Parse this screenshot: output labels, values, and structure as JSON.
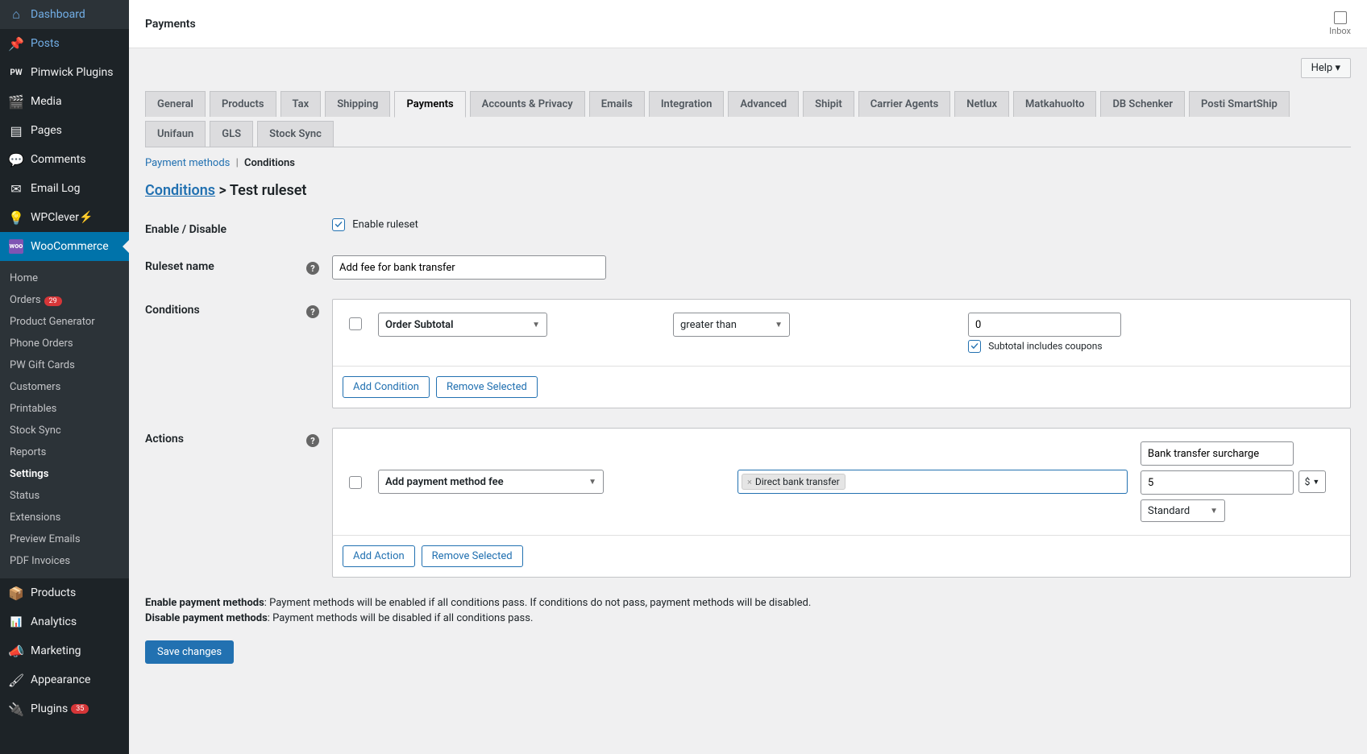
{
  "topbar": {
    "title": "Payments",
    "inbox": "Inbox",
    "help": "Help"
  },
  "sidebar": {
    "items": [
      {
        "icon": "dashboard",
        "label": "Dashboard"
      },
      {
        "icon": "pin",
        "label": "Posts",
        "class": "posts"
      },
      {
        "icon": "pw",
        "label": "Pimwick Plugins"
      },
      {
        "icon": "media",
        "label": "Media"
      },
      {
        "icon": "pages",
        "label": "Pages"
      },
      {
        "icon": "comments",
        "label": "Comments"
      },
      {
        "icon": "email",
        "label": "Email Log"
      },
      {
        "icon": "wpclever",
        "label": "WPClever",
        "lightning": true
      },
      {
        "icon": "woo",
        "label": "WooCommerce",
        "active": true
      },
      {
        "icon": "products",
        "label": "Products"
      },
      {
        "icon": "analytics",
        "label": "Analytics"
      },
      {
        "icon": "marketing",
        "label": "Marketing"
      },
      {
        "icon": "appearance",
        "label": "Appearance"
      },
      {
        "icon": "plugins",
        "label": "Plugins",
        "badge": "35"
      }
    ],
    "submenu": [
      {
        "label": "Home"
      },
      {
        "label": "Orders",
        "badge": "29"
      },
      {
        "label": "Product Generator"
      },
      {
        "label": "Phone Orders"
      },
      {
        "label": "PW Gift Cards"
      },
      {
        "label": "Customers"
      },
      {
        "label": "Printables"
      },
      {
        "label": "Stock Sync"
      },
      {
        "label": "Reports"
      },
      {
        "label": "Settings",
        "current": true
      },
      {
        "label": "Status"
      },
      {
        "label": "Extensions"
      },
      {
        "label": "Preview Emails"
      },
      {
        "label": "PDF Invoices"
      }
    ]
  },
  "tabs": [
    "General",
    "Products",
    "Tax",
    "Shipping",
    "Payments",
    "Accounts & Privacy",
    "Emails",
    "Integration",
    "Advanced",
    "Shipit",
    "Carrier Agents",
    "Netlux",
    "Matkahuolto",
    "DB Schenker",
    "Posti SmartShip",
    "Unifaun",
    "GLS",
    "Stock Sync"
  ],
  "active_tab": "Payments",
  "breadcrumb": {
    "link": "Payment methods",
    "current": "Conditions"
  },
  "page_title": {
    "link": "Conditions",
    "sep": " > ",
    "name": "Test ruleset"
  },
  "form": {
    "enable_label": "Enable / Disable",
    "enable_check": "Enable ruleset",
    "name_label": "Ruleset name",
    "name_value": "Add fee for bank transfer",
    "conditions_label": "Conditions",
    "actions_label": "Actions"
  },
  "condition_row": {
    "field": "Order Subtotal",
    "operator": "greater than",
    "value": "0",
    "extra": "Subtotal includes coupons"
  },
  "action_row": {
    "field": "Add payment method fee",
    "tag": "Direct bank transfer",
    "name": "Bank transfer surcharge",
    "amount": "5",
    "currency": "$",
    "tax": "Standard"
  },
  "buttons": {
    "add_condition": "Add Condition",
    "remove_selected": "Remove Selected",
    "add_action": "Add Action",
    "save": "Save changes"
  },
  "desc": {
    "enable_b": "Enable payment methods",
    "enable_t": ": Payment methods will be enabled if all conditions pass. If conditions do not pass, payment methods will be disabled.",
    "disable_b": "Disable payment methods",
    "disable_t": ": Payment methods will be disabled if all conditions pass."
  }
}
